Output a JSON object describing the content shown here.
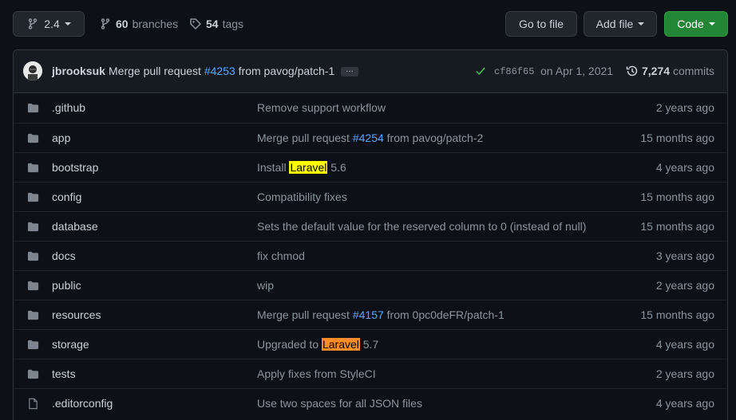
{
  "toolbar": {
    "branch": "2.4",
    "branches_count": "60",
    "branches_label": "branches",
    "tags_count": "54",
    "tags_label": "tags",
    "go_to_file": "Go to file",
    "add_file": "Add file",
    "code": "Code"
  },
  "commit": {
    "author": "jbrooksuk",
    "msg_prefix": "Merge pull request",
    "pr": "#4253",
    "msg_suffix": "from pavog/patch-1",
    "ellipsis": "…",
    "sha": "cf86f65",
    "date": "on Apr 1, 2021",
    "commits_count": "7,274",
    "commits_label": "commits"
  },
  "files": [
    {
      "name": ".github",
      "type": "dir",
      "msg": "Remove support workflow",
      "age": "2 years ago"
    },
    {
      "name": "app",
      "type": "dir",
      "msg_prefix": "Merge pull request ",
      "pr": "#4254",
      "msg_suffix": " from pavog/patch-2",
      "age": "15 months ago"
    },
    {
      "name": "bootstrap",
      "type": "dir",
      "msg_prefix": "Install ",
      "highlight": "Laravel",
      "msg_suffix": " 5.6",
      "age": "4 years ago"
    },
    {
      "name": "config",
      "type": "dir",
      "msg": "Compatibility fixes",
      "age": "15 months ago"
    },
    {
      "name": "database",
      "type": "dir",
      "msg": "Sets the default value for the reserved column to 0 (instead of null)",
      "age": "15 months ago"
    },
    {
      "name": "docs",
      "type": "dir",
      "msg": "fix chmod",
      "age": "3 years ago"
    },
    {
      "name": "public",
      "type": "dir",
      "msg": "wip",
      "age": "2 years ago"
    },
    {
      "name": "resources",
      "type": "dir",
      "msg_prefix": "Merge pull request ",
      "pr": "#4157",
      "msg_suffix": " from 0pc0deFR/patch-1",
      "age": "15 months ago"
    },
    {
      "name": "storage",
      "type": "dir",
      "msg_prefix": "Upgraded to ",
      "highlight": "Laravel",
      "msg_suffix": " 5.7",
      "age": "4 years ago"
    },
    {
      "name": "tests",
      "type": "dir",
      "msg": "Apply fixes from StyleCI",
      "age": "2 years ago"
    },
    {
      "name": ".editorconfig",
      "type": "file",
      "msg": "Use two spaces for all JSON files",
      "age": "4 years ago"
    }
  ],
  "colors": {
    "accent_link": "#58a6ff",
    "code_button": "#238636",
    "highlight_yellow": "#ffff00",
    "highlight_orange": "#ff8c26",
    "success_check": "#3fb950"
  }
}
